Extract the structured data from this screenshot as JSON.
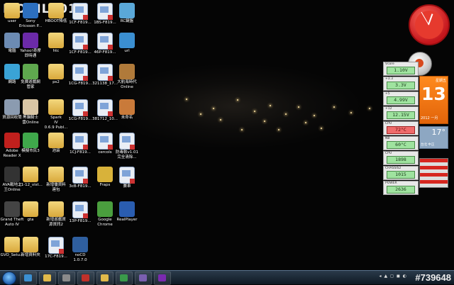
{
  "watermark": "MOBILE01",
  "desktop_icons": [
    {
      "label": "user",
      "kind": "folder",
      "color": "#e7c15a"
    },
    {
      "label": "Sony\nEricsson P...",
      "kind": "app",
      "color": "#2c6fbf"
    },
    {
      "label": "HBOOT降低",
      "kind": "folder",
      "color": "#e7c15a"
    },
    {
      "label": "1CF-F819...",
      "kind": "doc",
      "color": "#7fa4d8"
    },
    {
      "label": "1BS-F819...",
      "kind": "doc",
      "color": "#7fa4d8"
    },
    {
      "label": "RC鍵盤",
      "kind": "app",
      "color": "#5aa8d8"
    },
    {
      "label": "電腦",
      "kind": "app",
      "color": "#6c8bb3"
    },
    {
      "label": "Yahoo!奇摩\n即時通",
      "kind": "app",
      "color": "#6b2aa8"
    },
    {
      "label": "htc",
      "kind": "folder",
      "color": "#e7c15a"
    },
    {
      "label": "1CF-F819...",
      "kind": "doc",
      "color": "#7fa4d8"
    },
    {
      "label": "46P-F819...",
      "kind": "doc",
      "color": "#7fa4d8"
    },
    {
      "label": "url",
      "kind": "app",
      "color": "#3b8fd1"
    },
    {
      "label": "網路",
      "kind": "app",
      "color": "#3aa3d6"
    },
    {
      "label": "免費遊戲網\n管家",
      "kind": "app",
      "color": "#5fa84e"
    },
    {
      "label": "ps2",
      "kind": "folder",
      "color": "#e7c15a"
    },
    {
      "label": "1CG-F819...",
      "kind": "doc",
      "color": "#7fa4d8"
    },
    {
      "label": "321138_17...",
      "kind": "doc",
      "color": "#7fa4d8"
    },
    {
      "label": "大航海時代\nOnline",
      "kind": "app",
      "color": "#b07a3a"
    },
    {
      "label": "資源回收筒",
      "kind": "app",
      "color": "#8b9bb0"
    },
    {
      "label": "黑貓騎士\n雲Online",
      "kind": "app",
      "color": "#d9c6a5"
    },
    {
      "label": "Spark\nIV\n0.6.9 Publ...",
      "kind": "folder",
      "color": "#e7c15a"
    },
    {
      "label": "1CG-F819...",
      "kind": "doc",
      "color": "#7fa4d8"
    },
    {
      "label": "381712_10...",
      "kind": "doc",
      "color": "#7fa4d8"
    },
    {
      "label": "未命名",
      "kind": "app",
      "color": "#c97a3a"
    },
    {
      "label": "Adobe\nReader X",
      "kind": "app",
      "color": "#c0201d"
    },
    {
      "label": "模擬市民3",
      "kind": "app",
      "color": "#3fa84b"
    },
    {
      "label": "池袋",
      "kind": "folder",
      "color": "#e7c15a"
    },
    {
      "label": "1CJ-F819...",
      "kind": "doc",
      "color": "#7fa4d8"
    },
    {
      "label": "cercols",
      "kind": "doc",
      "color": "#dfe6ef"
    },
    {
      "label": "防毒軟v1.01\n完全清除...",
      "kind": "doc",
      "color": "#dfe6ef"
    },
    {
      "label": "AVA戰地之\n王Online",
      "kind": "app",
      "color": "#333333"
    },
    {
      "label": "11-12_vist...",
      "kind": "folder",
      "color": "#e7c15a"
    },
    {
      "label": "新增優資料\n連包",
      "kind": "folder",
      "color": "#e7c15a"
    },
    {
      "label": "3cB-F819...",
      "kind": "doc",
      "color": "#7fa4d8"
    },
    {
      "label": "Fraps",
      "kind": "app",
      "color": "#d8b23a"
    },
    {
      "label": "賽車",
      "kind": "doc",
      "color": "#3a6fc9"
    },
    {
      "label": "Grand Theft\nAuto IV",
      "kind": "app",
      "color": "#444444"
    },
    {
      "label": "gta",
      "kind": "folder",
      "color": "#e7c15a"
    },
    {
      "label": "新增遊戲資\n源資訊2",
      "kind": "folder",
      "color": "#e7c15a"
    },
    {
      "label": "13P-F819...",
      "kind": "doc",
      "color": "#7fa4d8"
    },
    {
      "label": "Google\nChrome",
      "kind": "app",
      "color": "#4a9e3e"
    },
    {
      "label": "RealPlayer",
      "kind": "app",
      "color": "#2a5db0"
    },
    {
      "label": "GVO_Setu...",
      "kind": "folder",
      "color": "#e7c15a"
    },
    {
      "label": "新增資料夾",
      "kind": "folder",
      "color": "#e7c15a"
    },
    {
      "label": "17C-F819...",
      "kind": "doc",
      "color": "#7fa4d8"
    },
    {
      "label": "noCD\n1.0.7.0",
      "kind": "app",
      "color": "#2f5f9f"
    }
  ],
  "gadgets": {
    "meters": [
      {
        "caption": "Vcore",
        "value": "1.10V",
        "alarm": false
      },
      {
        "caption": "+3.3",
        "value": "3.3V",
        "alarm": false
      },
      {
        "caption": "+5",
        "value": "4.99V",
        "alarm": false
      },
      {
        "caption": "+12",
        "value": "12.15V",
        "alarm": false
      },
      {
        "caption": "CPU",
        "value": "72°C",
        "alarm": true
      },
      {
        "caption": "NB",
        "value": "60°C",
        "alarm": false
      },
      {
        "caption": "CPU",
        "value": "1898",
        "alarm": false
      },
      {
        "caption": "CHASSIS2",
        "value": "1015",
        "alarm": false
      },
      {
        "caption": "POWER",
        "value": "2636",
        "alarm": false
      }
    ],
    "calendar": {
      "weekday": "星期五",
      "day": "13",
      "year_month": "2012 一月"
    },
    "weather": {
      "temp": "17°",
      "location": "台北 中正"
    },
    "ad_rows": [
      "",
      "",
      "",
      "",
      "",
      "",
      ""
    ]
  },
  "taskbar": {
    "stamp": "#739648",
    "buttons": [
      "ie",
      "folder",
      "media",
      "pepper",
      "folder2",
      "gamepad",
      "settings",
      "yahoo"
    ]
  }
}
